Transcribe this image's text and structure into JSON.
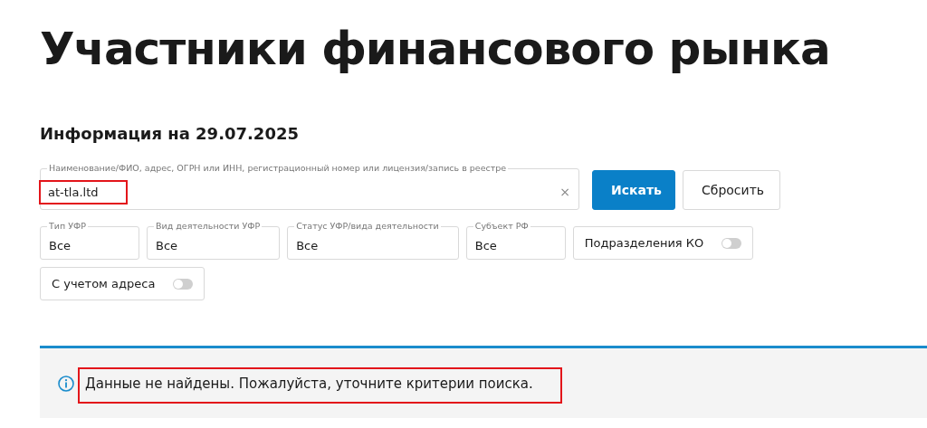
{
  "title": "Участники финансового рынка",
  "subtitle": "Информация на 29.07.2025",
  "search": {
    "label": "Наименование/ФИО, адрес, ОГРН или ИНН, регистрационный номер или лицензия/запись в реестре",
    "value": "at-tla.ltd",
    "clear": "×",
    "highlighted": true
  },
  "buttons": [
    {
      "label": "Искать",
      "kind": "primary"
    },
    {
      "label": "Сбросить",
      "kind": "secondary"
    }
  ],
  "filters": [
    {
      "kind": "select",
      "label": "Тип УФР",
      "value": "Все"
    },
    {
      "kind": "select",
      "label": "Вид деятельности УФР",
      "value": "Все"
    },
    {
      "kind": "select",
      "label": "Статус УФР/вида деятельности",
      "value": "Все"
    },
    {
      "kind": "select",
      "label": "Субъект РФ",
      "value": "Все"
    },
    {
      "kind": "toggle",
      "label": "Подразделения КО",
      "on": false
    },
    {
      "kind": "toggle",
      "label": "С учетом адреса",
      "on": false
    }
  ],
  "message": {
    "text": "Данные не найдены. Пожалуйста, уточните критерии поиска.",
    "highlighted": true
  }
}
